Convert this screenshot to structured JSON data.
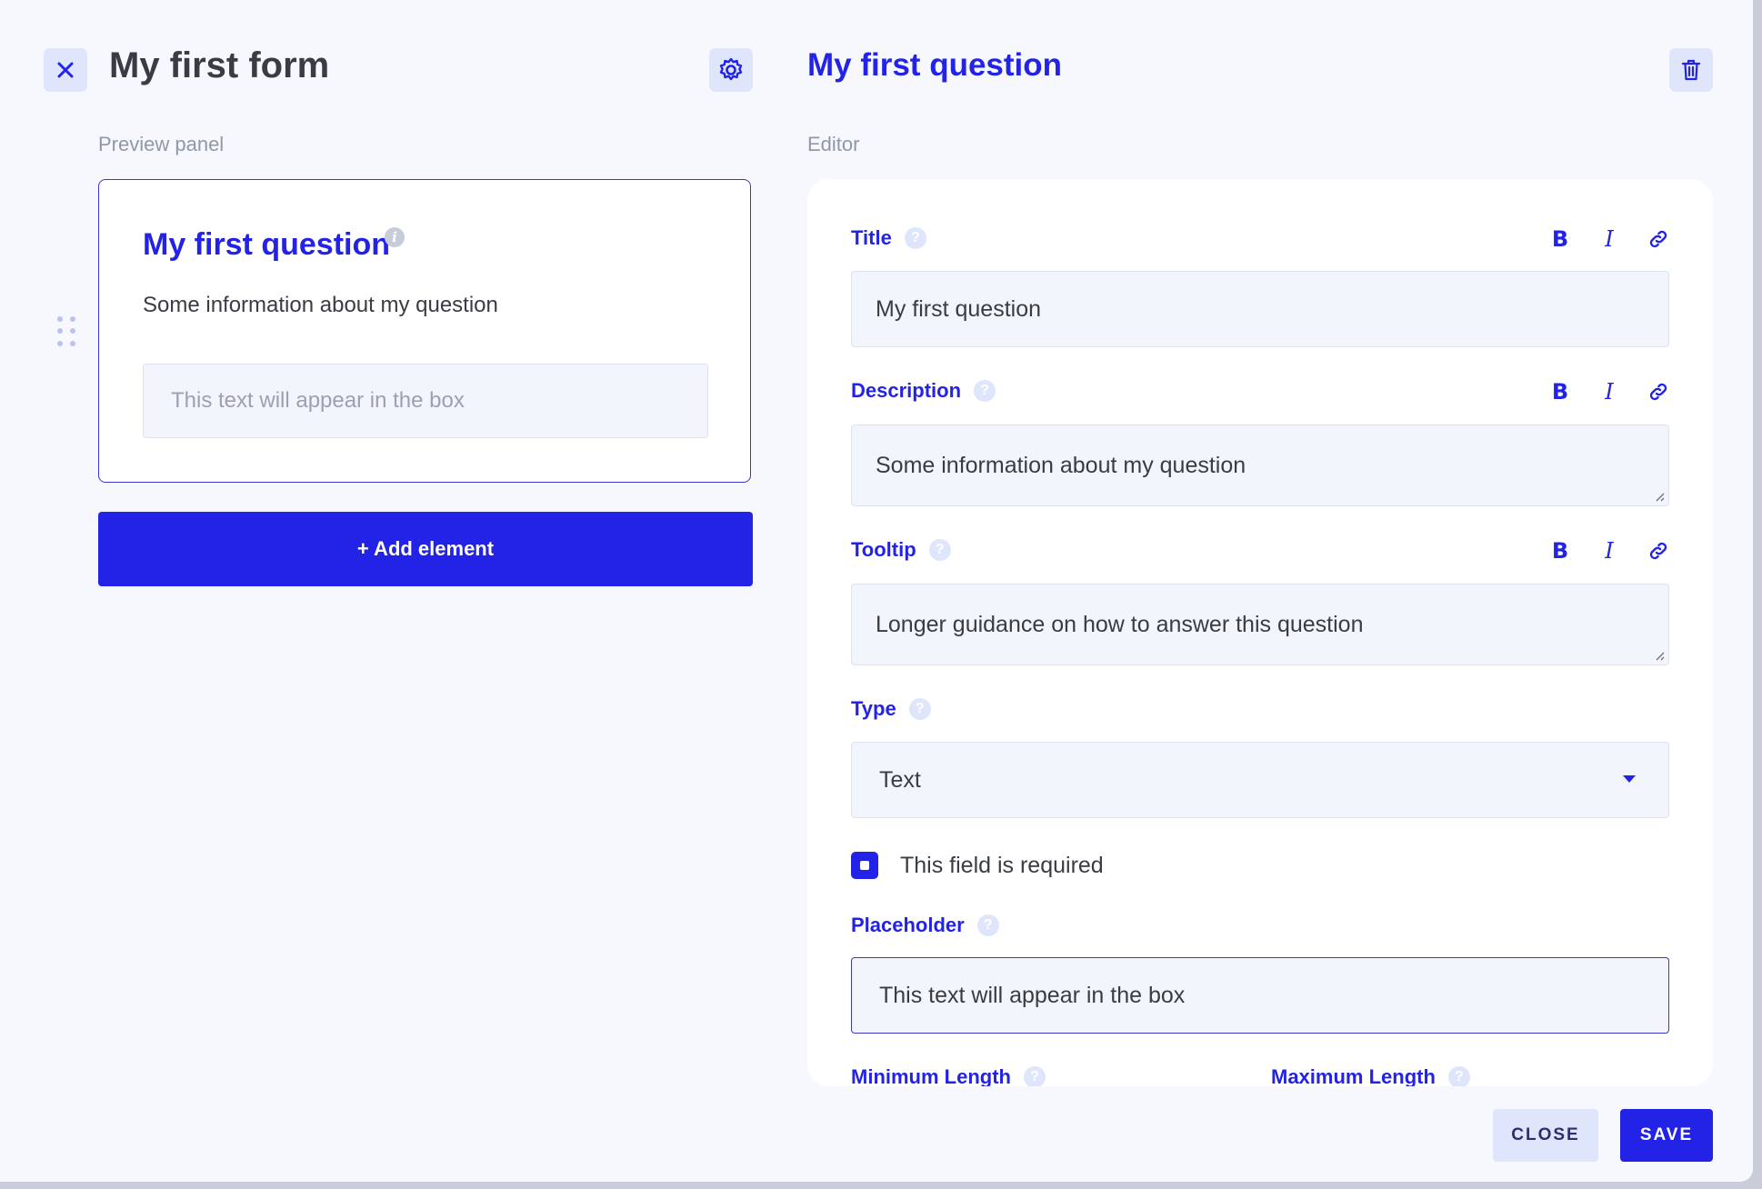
{
  "header": {
    "form_title": "My first form",
    "panel_title": "My first question"
  },
  "preview": {
    "section_label": "Preview panel",
    "question_title": "My first question",
    "question_description": "Some information about my question",
    "input_placeholder": "This text will appear in the box",
    "add_element_label": "+ Add element"
  },
  "editor": {
    "section_label": "Editor",
    "title": {
      "label": "Title",
      "value": "My first question"
    },
    "description": {
      "label": "Description",
      "value": "Some information about my question"
    },
    "tooltip": {
      "label": "Tooltip",
      "value": "Longer guidance on how to answer this question"
    },
    "type": {
      "label": "Type",
      "value": "Text"
    },
    "required": {
      "label": "This field is required",
      "checked": true
    },
    "placeholder": {
      "label": "Placeholder",
      "value": "This text will appear in the box"
    },
    "min_length": {
      "label": "Minimum Length"
    },
    "max_length": {
      "label": "Maximum Length"
    },
    "format": {
      "bold": "B",
      "italic": "I"
    },
    "help_glyph": "?",
    "info_glyph": "i"
  },
  "footer": {
    "close_label": "CLOSE",
    "save_label": "SAVE"
  },
  "colors": {
    "accent": "#2323e8",
    "background": "#f7f8fd",
    "field_background": "#f3f5fd",
    "soft_button": "#dfe5fb"
  },
  "icons": [
    "close-icon",
    "gear-icon",
    "trash-icon",
    "drag-handle-icon",
    "link-icon",
    "help-icon",
    "info-icon",
    "chevron-down-icon"
  ]
}
